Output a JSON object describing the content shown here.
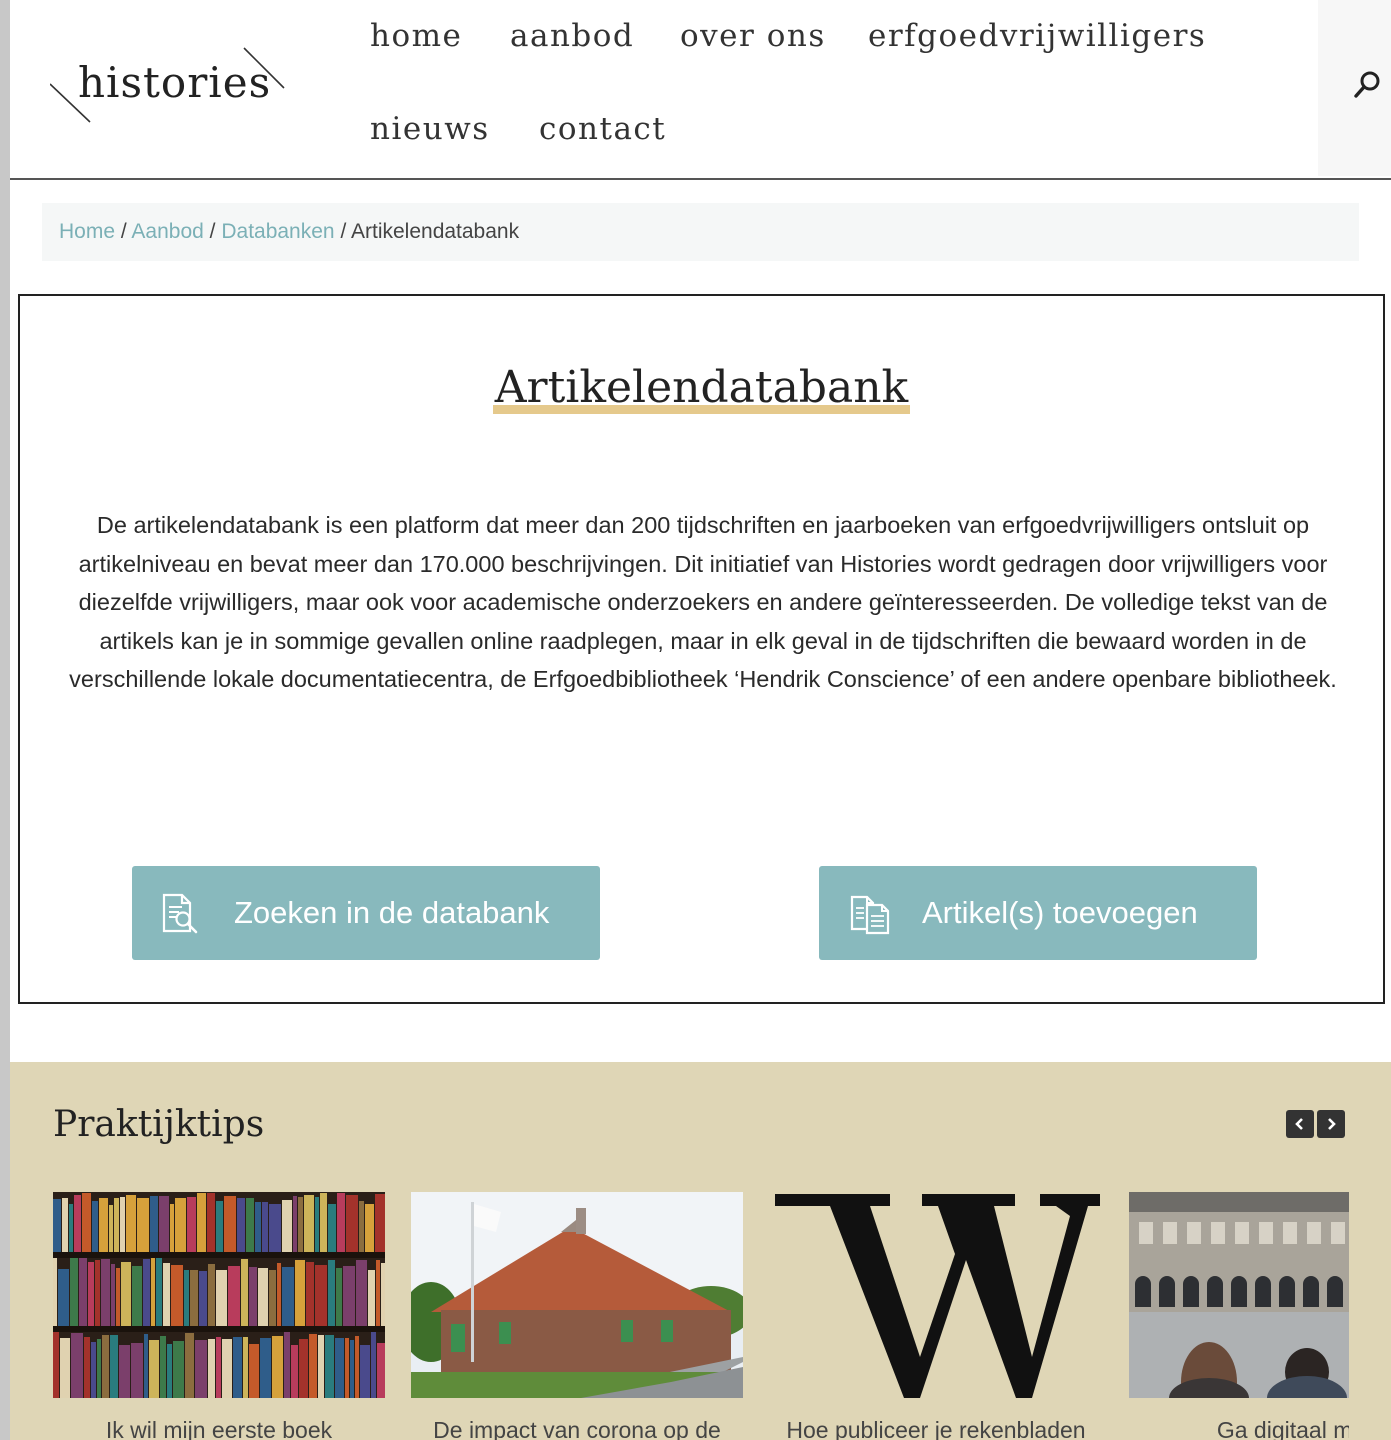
{
  "logo": {
    "text": "histories"
  },
  "nav": {
    "items": [
      {
        "label": "home"
      },
      {
        "label": "aanbod"
      },
      {
        "label": "over ons"
      },
      {
        "label": "erfgoedvrijwilligers"
      },
      {
        "label": "nieuws"
      },
      {
        "label": "contact"
      }
    ]
  },
  "search": {
    "icon": "search-icon"
  },
  "breadcrumb": {
    "items": [
      "Home",
      "Aanbod",
      "Databanken"
    ],
    "separator": "/",
    "current": "Artikelendatabank"
  },
  "main": {
    "title": "Artikelendatabank",
    "intro": "De artikelendatabank is een platform dat meer dan 200 tijdschriften en jaarboeken van erfgoedvrijwilligers ontsluit op artikelniveau en bevat meer dan 170.000 beschrijvingen. Dit initiatief van Histories wordt gedragen door vrijwilligers voor diezelfde vrijwilligers, maar ook voor academische onderzoekers en andere geïnteresseerden. De volledige tekst van de artikels kan je in sommige gevallen online raadplegen, maar in elk geval in de tijdschriften die bewaard worden in de verschillende lokale documentatiecentra, de Erfgoedbibliotheek ‘Hendrik Conscience’ of een andere openbare bibliotheek.",
    "buttons": [
      {
        "label": "Zoeken in de databank",
        "icon": "document-search-icon"
      },
      {
        "label": "Artikel(s) toevoegen",
        "icon": "documents-icon"
      }
    ]
  },
  "tips": {
    "title": "Praktijktips",
    "cards": [
      {
        "caption": "Ik wil mijn eerste boek",
        "image": "bookshelf-photo"
      },
      {
        "caption": "De impact van corona op de",
        "image": "brick-farmhouse-photo"
      },
      {
        "caption": "Hoe publiceer je rekenbladen",
        "image": "wikipedia-w-logo"
      },
      {
        "caption": "Ga digitaal me",
        "image": "town-hall-square-photo"
      }
    ]
  },
  "colors": {
    "accent": "#88b9bd",
    "link": "#7bb0b6",
    "title_underline": "#e5c98c",
    "tips_background": "#dfd6b6"
  }
}
